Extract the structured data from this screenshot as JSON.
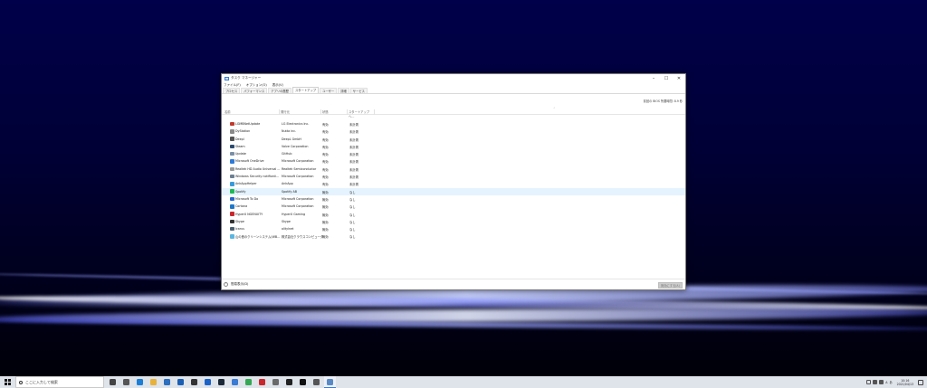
{
  "window": {
    "title": "タスク マネージャー",
    "controls": [
      "–",
      "☐",
      "✕"
    ],
    "menu": [
      "ファイル(F)",
      "オプション(O)",
      "表示(V)"
    ],
    "tabs": [
      "プロセス",
      "パフォーマンス",
      "アプリの履歴",
      "スタートアップ",
      "ユーザー",
      "詳細",
      "サービス"
    ],
    "active_tab": "スタートアップ",
    "bios_time": "前回の BIOS 所要時間: 8.9 秒"
  },
  "table": {
    "columns": [
      "名前",
      "発行元",
      "状態",
      "スタートアップへ..."
    ],
    "rows": [
      {
        "name": "LGMBNetUpdate",
        "publisher": "LG Electronics Inc.",
        "status": "有効",
        "impact": "未計測",
        "color": "#c0392b"
      },
      {
        "name": "DyStation",
        "publisher": "Nutta inc.",
        "status": "有効",
        "impact": "未計測",
        "color": "#8a8a8a"
      },
      {
        "name": "Deepl",
        "publisher": "DeepL GmbH",
        "status": "有効",
        "impact": "未計測",
        "color": "#555555"
      },
      {
        "name": "Steam",
        "publisher": "Valve Corporation",
        "status": "有効",
        "impact": "未計測",
        "color": "#2c4a6e"
      },
      {
        "name": "Update",
        "publisher": "GitHub",
        "status": "有効",
        "impact": "未計測",
        "color": "#7a8fa6"
      },
      {
        "name": "Microsoft OneDrive",
        "publisher": "Microsoft Corporation",
        "status": "有効",
        "impact": "未計測",
        "color": "#2f7ad6"
      },
      {
        "name": "Realtek HD Audio Universal ...",
        "publisher": "Realtek Semiconductor",
        "status": "有効",
        "impact": "未計測",
        "color": "#9a9a9a"
      },
      {
        "name": "Windows Security notificati...",
        "publisher": "Microsoft Corporation",
        "status": "有効",
        "impact": "未計測",
        "color": "#6d7f92"
      },
      {
        "name": "AnkAppHelper",
        "publisher": "AnkApp",
        "status": "有効",
        "impact": "未計測",
        "color": "#3a9ad9"
      },
      {
        "name": "Spotify",
        "publisher": "Spotify AB",
        "status": "無効",
        "impact": "なし",
        "color": "#1db954"
      },
      {
        "name": "Microsoft To Do",
        "publisher": "Microsoft Corporation",
        "status": "無効",
        "impact": "なし",
        "color": "#2564cf"
      },
      {
        "name": "Cortana",
        "publisher": "Microsoft Corporation",
        "status": "無効",
        "impact": "なし",
        "color": "#1e78c8"
      },
      {
        "name": "HyperX NGENUITY",
        "publisher": "HyperX Gaming",
        "status": "無効",
        "impact": "なし",
        "color": "#c8282d"
      },
      {
        "name": "Skype",
        "publisher": "Skype",
        "status": "無効",
        "impact": "なし",
        "color": "#333333"
      },
      {
        "name": "Icarus",
        "publisher": "olitylnet",
        "status": "無効",
        "impact": "なし",
        "color": "#4a6070"
      },
      {
        "name": "山の音のクリーンシステム(WB...",
        "publisher": "株式会社クラウスコンピューター",
        "status": "無効",
        "impact": "なし",
        "color": "#5bb5e0"
      }
    ]
  },
  "footer": {
    "less_label": "簡易表示(D)",
    "disable_label": "無効にする(A)"
  },
  "taskbar": {
    "search_placeholder": "ここに入力して検索",
    "time": "10:16",
    "date": "2021/04/13",
    "icons": [
      {
        "name": "task-view-icon",
        "color": "#444444"
      },
      {
        "name": "cortana-icon",
        "color": "#555555"
      },
      {
        "name": "edge-icon",
        "color": "#1c7ed6"
      },
      {
        "name": "file-explorer-icon",
        "color": "#e8b23a"
      },
      {
        "name": "store-icon",
        "color": "#2c6ebf"
      },
      {
        "name": "outlook-icon",
        "color": "#1a5fb4"
      },
      {
        "name": "app-icon-1",
        "color": "#333333"
      },
      {
        "name": "mail-icon",
        "color": "#1b62c8"
      },
      {
        "name": "steam-icon",
        "color": "#1b2838"
      },
      {
        "name": "photos-icon",
        "color": "#3a7bd5"
      },
      {
        "name": "chrome-icon",
        "color": "#34a853"
      },
      {
        "name": "app-icon-2",
        "color": "#c8282d"
      },
      {
        "name": "app-icon-3",
        "color": "#6a6a6a"
      },
      {
        "name": "app-icon-4",
        "color": "#222222"
      },
      {
        "name": "terminal-icon",
        "color": "#111111"
      },
      {
        "name": "settings-icon",
        "color": "#555555"
      },
      {
        "name": "task-manager-icon",
        "color": "#5a8ac6"
      }
    ]
  },
  "tray": {
    "ime": "A",
    "lang": "あ"
  }
}
